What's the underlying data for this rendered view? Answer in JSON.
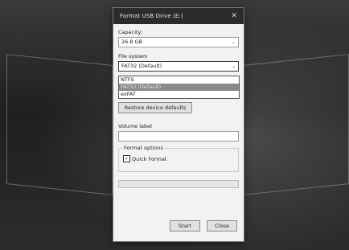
{
  "dialog": {
    "title": "Format USB Drive (E:)",
    "capacity_label": "Capacity:",
    "capacity_value": "26.8 GB",
    "filesystem_label": "File system",
    "filesystem_value": "FAT32 (Default)",
    "filesystem_options": [
      "NTFS",
      "FAT32 (Default)",
      "exFAT"
    ],
    "restore_label": "Restore device defaults",
    "volume_label": "Volume label",
    "volume_value": "",
    "format_options_label": "Format options",
    "quick_format_label": "Quick Format",
    "quick_format_checked": true,
    "progress": 0,
    "start_label": "Start",
    "close_label": "Close"
  }
}
